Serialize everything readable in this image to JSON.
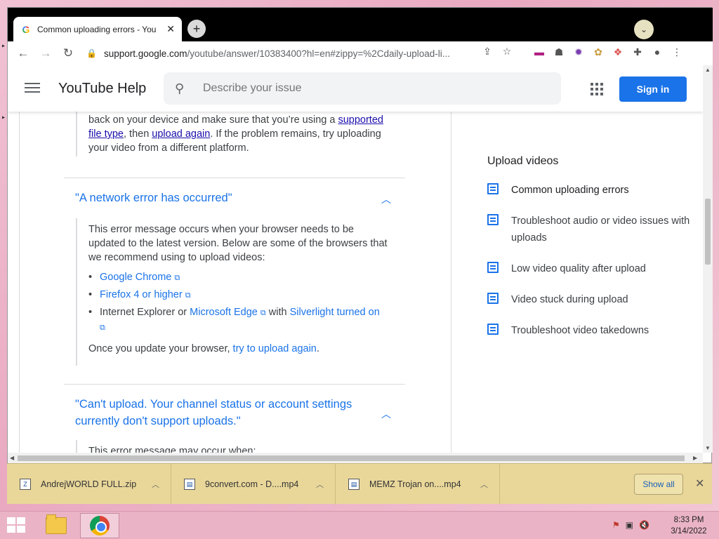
{
  "browser": {
    "tab_title": "Common uploading errors - You",
    "tab_close": "✕",
    "new_tab": "+",
    "url_host": "support.google.com",
    "url_rest": "/youtube/answer/10383400?hl=en#zippy=%2Cdaily-upload-li..."
  },
  "header": {
    "site_title": "YouTube Help",
    "search_placeholder": "Describe your issue",
    "sign_in": "Sign in"
  },
  "article": {
    "top_para": {
      "t1": "back on your device and make sure that you’re using a ",
      "link1a": "supported",
      "link1b": "file type",
      "t2": ", then ",
      "link2": "upload again",
      "t3": ". If the problem remains, try uploading",
      "t4": "your video from a different platform."
    },
    "network_error": {
      "title": "\"A network error has occurred\"",
      "para1": "This error message occurs when your browser needs to be",
      "para2": "updated to the latest version. Below are some of the browsers that",
      "para3": "we recommend using to upload videos:",
      "b1": "Google Chrome",
      "b2": "Firefox 4 or higher",
      "b3_pre": "Internet Explorer or ",
      "b3_link": "Microsoft Edge",
      "b3_mid": " with ",
      "b3_link2": "Silverlight turned on",
      "outro_pre": "Once you update your browser, ",
      "outro_link": "try to upload again",
      "outro_post": "."
    },
    "channel_error": {
      "title1": "\"Can't upload. Your channel status or account settings",
      "title2": "currently don't support uploads.\"",
      "para": "This error message may occur when:"
    }
  },
  "sidebar": {
    "title": "Upload videos",
    "items": [
      {
        "label": "Common uploading errors"
      },
      {
        "label": "Troubleshoot audio or video issues with",
        "label2": "uploads"
      },
      {
        "label": "Low video quality after upload"
      },
      {
        "label": "Video stuck during upload"
      },
      {
        "label": "Troubleshoot video takedowns"
      }
    ]
  },
  "downloads": {
    "items": [
      {
        "name": "AndrejWORLD FULL.zip"
      },
      {
        "name": "9convert.com - D....mp4"
      },
      {
        "name": "MEMZ Trojan on....mp4"
      }
    ],
    "show_all": "Show all"
  },
  "taskbar": {
    "time": "8:33 PM",
    "date": "3/14/2022"
  },
  "colors": {
    "link_blue": "#1a73e8",
    "sign_in_blue": "#1a73e8",
    "shelf": "#e9d79a",
    "desktop_pink": "#eab4c6"
  }
}
